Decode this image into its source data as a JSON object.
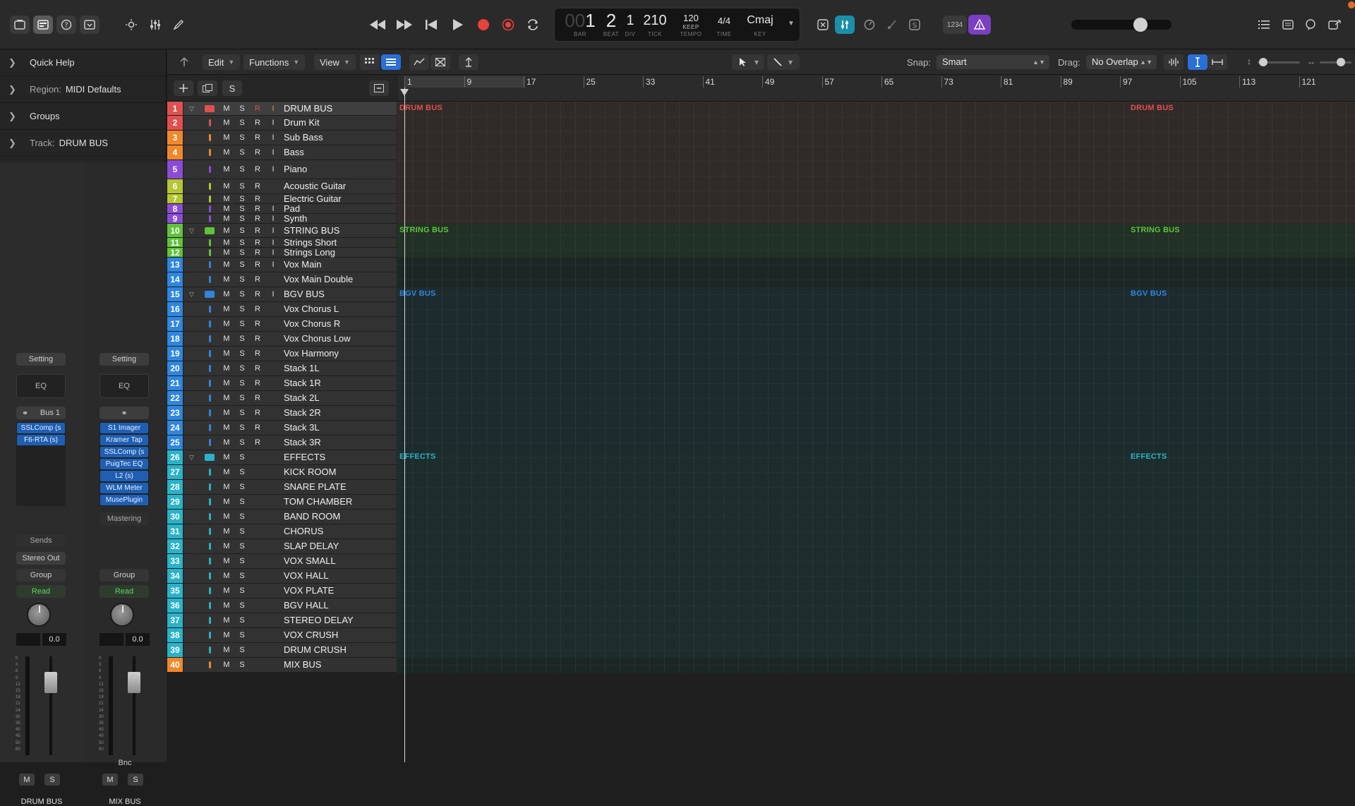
{
  "colors": {
    "red": "#e05050",
    "orange": "#f0882b",
    "yellow_green": "#b5c632",
    "purple": "#8a4cd6",
    "green": "#5fc33a",
    "blue": "#2e86de",
    "teal": "#2ab2c8",
    "accent_blue": "#2a6fd6",
    "read_green": "#5fd35f"
  },
  "icons": {
    "library": "library-icon",
    "inspector": "inspector-icon",
    "quick_help": "question-icon",
    "toolbar": "toolbar-icon",
    "smart_controls": "brightness-icon",
    "mixer": "mixer-icon",
    "editors": "pencil-icon"
  },
  "lcd": {
    "bar_prefix": "00",
    "bar": "1",
    "beat": "2",
    "div": "1",
    "tick": "210",
    "tempo": "120",
    "tempo_sub": "KEEP",
    "time_sig_top": "4",
    "time_sig_bottom": "4",
    "key": "Cmaj",
    "labels": {
      "bar": "BAR",
      "beat": "BEAT",
      "div": "DIV",
      "tick": "TICK",
      "tempo": "TEMPO",
      "time": "TIME",
      "key": "KEY"
    }
  },
  "control_bar": {
    "mode_label": "1234"
  },
  "inspector": {
    "quick_help": "Quick Help",
    "region_prefix": "Region:",
    "region_value": "MIDI Defaults",
    "groups": "Groups",
    "track_prefix": "Track:",
    "track_value": "DRUM BUS",
    "strips": [
      {
        "setting": "Setting",
        "eq": "EQ",
        "input": "Bus 1",
        "plugins": [
          "SSLComp (s",
          "F6-RTA (s)"
        ],
        "extra": "",
        "sends": "Sends",
        "output": "Stereo Out",
        "group": "Group",
        "automation": "Read",
        "volume": "0.0",
        "bounce": "",
        "mute": "M",
        "solo": "S",
        "name": "DRUM BUS"
      },
      {
        "setting": "Setting",
        "eq": "EQ",
        "input": "",
        "plugins": [
          "S1 Imager",
          "Kramer Tap",
          "SSLComp (s",
          "PuigTec EQ",
          "L2 (s)",
          "WLM Meter",
          "MusePlugin"
        ],
        "extra": "Mastering",
        "sends": "",
        "output": "",
        "group": "Group",
        "automation": "Read",
        "volume": "0.0",
        "bounce": "Bnc",
        "mute": "M",
        "solo": "S",
        "name": "MIX BUS"
      }
    ],
    "meter_scale": [
      "0",
      "3",
      "6",
      "9",
      "12",
      "15",
      "18",
      "21",
      "24",
      "30",
      "35",
      "40",
      "45",
      "50",
      "60"
    ]
  },
  "toolbar": {
    "edit": "Edit",
    "functions": "Functions",
    "view": "View",
    "snap_label": "Snap:",
    "snap_value": "Smart",
    "drag_label": "Drag:",
    "drag_value": "No Overlap"
  },
  "header_toolbar": {
    "solo_label": "S"
  },
  "ruler": {
    "bars": [
      "1",
      "9",
      "17",
      "25",
      "33",
      "41",
      "49",
      "57",
      "65",
      "73",
      "81",
      "89",
      "97",
      "105",
      "113",
      "121"
    ]
  },
  "tracks": [
    {
      "num": "1",
      "name": "DRUM BUS",
      "color": "#e05050",
      "folder": true,
      "btns": [
        "M",
        "S",
        "R",
        "I"
      ],
      "r_on": true,
      "i_on": true,
      "sel": true
    },
    {
      "num": "2",
      "name": "Drum Kit",
      "color": "#e05050",
      "btns": [
        "M",
        "S",
        "R",
        "I"
      ]
    },
    {
      "num": "3",
      "name": "Sub Bass",
      "color": "#f0882b",
      "btns": [
        "M",
        "S",
        "R",
        "I"
      ]
    },
    {
      "num": "4",
      "name": "Bass",
      "color": "#f0882b",
      "btns": [
        "M",
        "S",
        "R",
        "I"
      ]
    },
    {
      "num": "5",
      "name": "Piano",
      "color": "#8a4cd6",
      "btns": [
        "M",
        "S",
        "R",
        "I"
      ]
    },
    {
      "num": "6",
      "name": "Acoustic Guitar",
      "color": "#b5c632",
      "btns": [
        "M",
        "S",
        "R"
      ]
    },
    {
      "num": "7",
      "name": "Electric Guitar",
      "color": "#b5c632",
      "btns": [
        "M",
        "S",
        "R"
      ]
    },
    {
      "num": "8",
      "name": "Pad",
      "color": "#8a4cd6",
      "btns": [
        "M",
        "S",
        "R",
        "I"
      ]
    },
    {
      "num": "9",
      "name": "Synth",
      "color": "#8a4cd6",
      "btns": [
        "M",
        "S",
        "R",
        "I"
      ]
    },
    {
      "num": "10",
      "name": "STRING BUS",
      "color": "#5fc33a",
      "folder": true,
      "btns": [
        "M",
        "S",
        "R",
        "I"
      ]
    },
    {
      "num": "11",
      "name": "Strings Short",
      "color": "#5fc33a",
      "btns": [
        "M",
        "S",
        "R",
        "I"
      ]
    },
    {
      "num": "12",
      "name": "Strings Long",
      "color": "#5fc33a",
      "btns": [
        "M",
        "S",
        "R",
        "I"
      ]
    },
    {
      "num": "13",
      "name": "Vox Main",
      "color": "#2e86de",
      "btns": [
        "M",
        "S",
        "R",
        "I"
      ]
    },
    {
      "num": "14",
      "name": "Vox Main Double",
      "color": "#2e86de",
      "btns": [
        "M",
        "S",
        "R"
      ]
    },
    {
      "num": "15",
      "name": "BGV BUS",
      "color": "#2e86de",
      "folder": true,
      "btns": [
        "M",
        "S",
        "R",
        "I"
      ]
    },
    {
      "num": "16",
      "name": "Vox Chorus L",
      "color": "#2e86de",
      "btns": [
        "M",
        "S",
        "R"
      ]
    },
    {
      "num": "17",
      "name": "Vox Chorus R",
      "color": "#2e86de",
      "btns": [
        "M",
        "S",
        "R"
      ]
    },
    {
      "num": "18",
      "name": "Vox Chorus Low",
      "color": "#2e86de",
      "btns": [
        "M",
        "S",
        "R"
      ]
    },
    {
      "num": "19",
      "name": "Vox Harmony",
      "color": "#2e86de",
      "btns": [
        "M",
        "S",
        "R"
      ]
    },
    {
      "num": "20",
      "name": "Stack 1L",
      "color": "#2e86de",
      "btns": [
        "M",
        "S",
        "R"
      ]
    },
    {
      "num": "21",
      "name": "Stack 1R",
      "color": "#2e86de",
      "btns": [
        "M",
        "S",
        "R"
      ]
    },
    {
      "num": "22",
      "name": "Stack 2L",
      "color": "#2e86de",
      "btns": [
        "M",
        "S",
        "R"
      ]
    },
    {
      "num": "23",
      "name": "Stack 2R",
      "color": "#2e86de",
      "btns": [
        "M",
        "S",
        "R"
      ]
    },
    {
      "num": "24",
      "name": "Stack 3L",
      "color": "#2e86de",
      "btns": [
        "M",
        "S",
        "R"
      ]
    },
    {
      "num": "25",
      "name": "Stack 3R",
      "color": "#2e86de",
      "btns": [
        "M",
        "S",
        "R"
      ]
    },
    {
      "num": "26",
      "name": "EFFECTS",
      "color": "#2ab2c8",
      "folder": true,
      "btns": [
        "M",
        "S"
      ]
    },
    {
      "num": "27",
      "name": "KICK ROOM",
      "color": "#2ab2c8",
      "btns": [
        "M",
        "S"
      ]
    },
    {
      "num": "28",
      "name": "SNARE PLATE",
      "color": "#2ab2c8",
      "btns": [
        "M",
        "S"
      ]
    },
    {
      "num": "29",
      "name": "TOM CHAMBER",
      "color": "#2ab2c8",
      "btns": [
        "M",
        "S"
      ]
    },
    {
      "num": "30",
      "name": "BAND ROOM",
      "color": "#2ab2c8",
      "btns": [
        "M",
        "S"
      ]
    },
    {
      "num": "31",
      "name": "CHORUS",
      "color": "#2ab2c8",
      "btns": [
        "M",
        "S"
      ]
    },
    {
      "num": "32",
      "name": "SLAP DELAY",
      "color": "#2ab2c8",
      "btns": [
        "M",
        "S"
      ]
    },
    {
      "num": "33",
      "name": "VOX SMALL",
      "color": "#2ab2c8",
      "btns": [
        "M",
        "S"
      ]
    },
    {
      "num": "34",
      "name": "VOX HALL",
      "color": "#2ab2c8",
      "btns": [
        "M",
        "S"
      ]
    },
    {
      "num": "35",
      "name": "VOX PLATE",
      "color": "#2ab2c8",
      "btns": [
        "M",
        "S"
      ]
    },
    {
      "num": "36",
      "name": "BGV HALL",
      "color": "#2ab2c8",
      "btns": [
        "M",
        "S"
      ]
    },
    {
      "num": "37",
      "name": "STEREO DELAY",
      "color": "#2ab2c8",
      "btns": [
        "M",
        "S"
      ]
    },
    {
      "num": "38",
      "name": "VOX CRUSH",
      "color": "#2ab2c8",
      "btns": [
        "M",
        "S"
      ]
    },
    {
      "num": "39",
      "name": "DRUM CRUSH",
      "color": "#2ab2c8",
      "btns": [
        "M",
        "S"
      ]
    },
    {
      "num": "40",
      "name": "MIX BUS",
      "color": "#f0882b",
      "btns": [
        "M",
        "S"
      ]
    }
  ],
  "lanes": [
    {
      "label": "DRUM BUS",
      "color": "#e05050"
    },
    {
      "label": "STRING BUS",
      "color": "#5fc33a"
    },
    {
      "label": "BGV BUS",
      "color": "#2e86de"
    },
    {
      "label": "EFFECTS",
      "color": "#2ab2c8"
    }
  ]
}
